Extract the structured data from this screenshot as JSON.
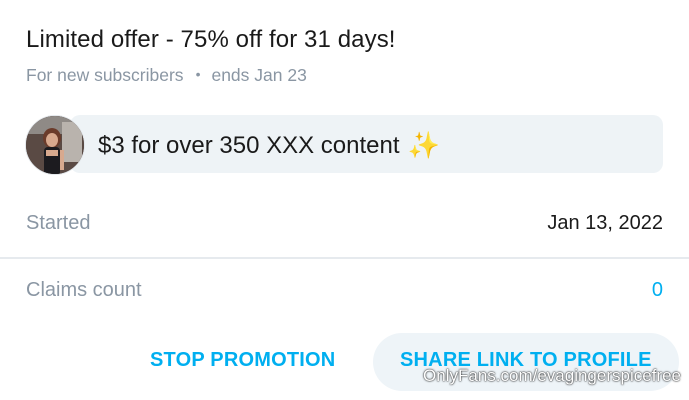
{
  "offer": {
    "title": "Limited offer - 75% off for 31 days!",
    "audience": "For new subscribers",
    "separator": "•",
    "ends": "ends Jan 23"
  },
  "message": {
    "text": "$3 for over 350 XXX content",
    "emoji": "✨"
  },
  "details": {
    "started_label": "Started",
    "started_value": "Jan 13, 2022",
    "claims_label": "Claims count",
    "claims_value": "0"
  },
  "actions": {
    "stop_label": "STOP PROMOTION",
    "share_label": "SHARE LINK TO PROFILE"
  },
  "watermark": {
    "text": "OnlyFans.com/evagingerspicefree"
  },
  "colors": {
    "accent": "#00aff0",
    "muted_text": "#8a96a3",
    "bubble_bg": "#eef3f6"
  }
}
